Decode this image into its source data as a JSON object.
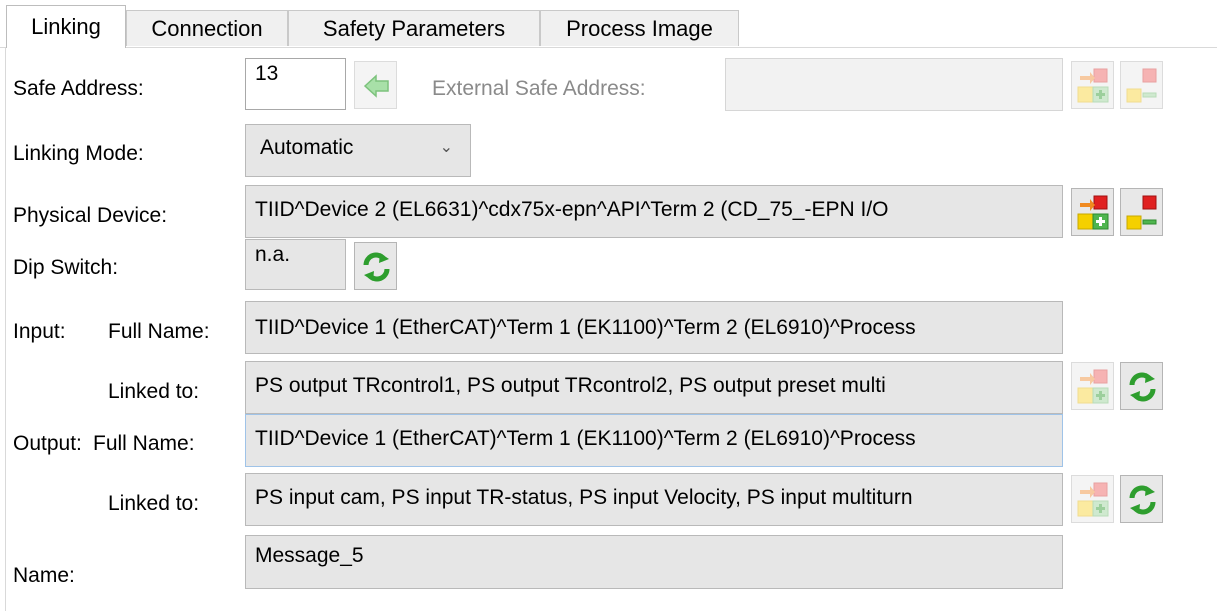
{
  "tabs": [
    {
      "label": "Linking",
      "active": true
    },
    {
      "label": "Connection"
    },
    {
      "label": "Safety Parameters"
    },
    {
      "label": "Process Image"
    }
  ],
  "safe_address": {
    "label": "Safe Address:",
    "value": "13"
  },
  "external_safe_address": {
    "label": "External Safe Address:",
    "value": ""
  },
  "linking_mode": {
    "label": "Linking Mode:",
    "selected": "Automatic"
  },
  "physical_device": {
    "label": "Physical Device:",
    "value": "TIID^Device 2 (EL6631)^cdx75x-epn^API^Term 2 (CD_75_-EPN I/O"
  },
  "dip_switch": {
    "label": "Dip Switch:",
    "value": "n.a."
  },
  "input": {
    "label": "Input:",
    "full_name_label": "Full Name:",
    "full_name": "TIID^Device 1 (EtherCAT)^Term 1 (EK1100)^Term 2 (EL6910)^Process",
    "linked_to_label": "Linked to:",
    "linked_to": "PS output TRcontrol1, PS output TRcontrol2, PS output preset multi"
  },
  "output": {
    "label": "Output:",
    "full_name_label": "Full Name:",
    "full_name": "TIID^Device 1 (EtherCAT)^Term 1 (EK1100)^Term 2 (EL6910)^Process",
    "linked_to_label": "Linked to:",
    "linked_to": "PS input cam, PS input TR-status, PS input Velocity, PS input multiturn"
  },
  "name": {
    "label": "Name:",
    "value": "Message_5"
  },
  "icons": {
    "apply": "green-arrow-left-icon",
    "add_link": "link-add-icon",
    "remove_link": "link-remove-icon",
    "refresh": "green-refresh-icon"
  },
  "colors": {
    "refresh_green": "#2e9e2e",
    "link_red": "#e02020",
    "link_yellow": "#f5d000",
    "apply_green": "#9ad89a"
  }
}
